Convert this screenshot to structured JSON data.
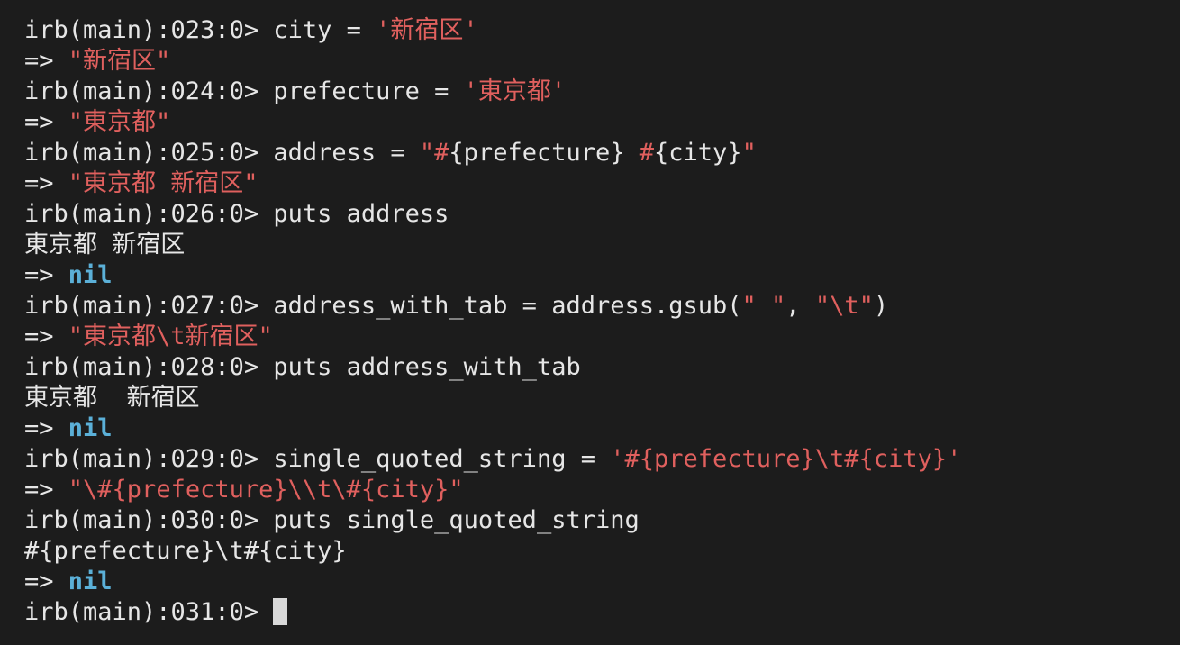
{
  "terminal": {
    "lines": [
      {
        "kind": "command",
        "segments": [
          {
            "text": "irb(main):023:0> ",
            "style": "plain"
          },
          {
            "text": "city = ",
            "style": "plain"
          },
          {
            "text": "'新宿区'",
            "style": "str"
          }
        ]
      },
      {
        "kind": "result",
        "segments": [
          {
            "text": "=> ",
            "style": "plain"
          },
          {
            "text": "\"新宿区\"",
            "style": "str"
          }
        ]
      },
      {
        "kind": "command",
        "segments": [
          {
            "text": "irb(main):024:0> ",
            "style": "plain"
          },
          {
            "text": "prefecture = ",
            "style": "plain"
          },
          {
            "text": "'東京都'",
            "style": "str"
          }
        ]
      },
      {
        "kind": "result",
        "segments": [
          {
            "text": "=> ",
            "style": "plain"
          },
          {
            "text": "\"東京都\"",
            "style": "str"
          }
        ]
      },
      {
        "kind": "command",
        "segments": [
          {
            "text": "irb(main):025:0> ",
            "style": "plain"
          },
          {
            "text": "address = ",
            "style": "plain"
          },
          {
            "text": "\"#",
            "style": "str"
          },
          {
            "text": "{prefecture}",
            "style": "plain"
          },
          {
            "text": " #",
            "style": "str"
          },
          {
            "text": "{city}",
            "style": "plain"
          },
          {
            "text": "\"",
            "style": "str"
          }
        ]
      },
      {
        "kind": "result",
        "segments": [
          {
            "text": "=> ",
            "style": "plain"
          },
          {
            "text": "\"東京都 新宿区\"",
            "style": "str"
          }
        ]
      },
      {
        "kind": "command",
        "segments": [
          {
            "text": "irb(main):026:0> ",
            "style": "plain"
          },
          {
            "text": "puts address",
            "style": "plain"
          }
        ]
      },
      {
        "kind": "output",
        "segments": [
          {
            "text": "東京都 新宿区",
            "style": "plain"
          }
        ]
      },
      {
        "kind": "result",
        "segments": [
          {
            "text": "=> ",
            "style": "plain"
          },
          {
            "text": "nil",
            "style": "nil"
          }
        ]
      },
      {
        "kind": "command",
        "segments": [
          {
            "text": "irb(main):027:0> ",
            "style": "plain"
          },
          {
            "text": "address_with_tab = address.gsub(",
            "style": "plain"
          },
          {
            "text": "\" \"",
            "style": "str"
          },
          {
            "text": ", ",
            "style": "plain"
          },
          {
            "text": "\"\\t\"",
            "style": "str"
          },
          {
            "text": ")",
            "style": "plain"
          }
        ]
      },
      {
        "kind": "result",
        "segments": [
          {
            "text": "=> ",
            "style": "plain"
          },
          {
            "text": "\"東京都\\t新宿区\"",
            "style": "str"
          }
        ]
      },
      {
        "kind": "command",
        "segments": [
          {
            "text": "irb(main):028:0> ",
            "style": "plain"
          },
          {
            "text": "puts address_with_tab",
            "style": "plain"
          }
        ]
      },
      {
        "kind": "output",
        "segments": [
          {
            "text": "東京都  新宿区",
            "style": "plain"
          }
        ]
      },
      {
        "kind": "result",
        "segments": [
          {
            "text": "=> ",
            "style": "plain"
          },
          {
            "text": "nil",
            "style": "nil"
          }
        ]
      },
      {
        "kind": "command",
        "segments": [
          {
            "text": "irb(main):029:0> ",
            "style": "plain"
          },
          {
            "text": "single_quoted_string = ",
            "style": "plain"
          },
          {
            "text": "'#{prefecture}\\t#{city}'",
            "style": "str"
          }
        ]
      },
      {
        "kind": "result",
        "segments": [
          {
            "text": "=> ",
            "style": "plain"
          },
          {
            "text": "\"\\#{prefecture}\\\\t\\#{city}\"",
            "style": "str"
          }
        ]
      },
      {
        "kind": "command",
        "segments": [
          {
            "text": "irb(main):030:0> ",
            "style": "plain"
          },
          {
            "text": "puts single_quoted_string",
            "style": "plain"
          }
        ]
      },
      {
        "kind": "output",
        "segments": [
          {
            "text": "#{prefecture}\\t#{city}",
            "style": "plain"
          }
        ]
      },
      {
        "kind": "result",
        "segments": [
          {
            "text": "=> ",
            "style": "plain"
          },
          {
            "text": "nil",
            "style": "nil"
          }
        ]
      },
      {
        "kind": "prompt",
        "segments": [
          {
            "text": "irb(main):031:0> ",
            "style": "plain"
          }
        ],
        "cursor": true
      }
    ],
    "colors": {
      "background": "#1c1c1c",
      "text": "#e6e6e6",
      "string": "#e0605e",
      "nil": "#5bb0d8",
      "cursor": "#d8d8d8"
    }
  }
}
